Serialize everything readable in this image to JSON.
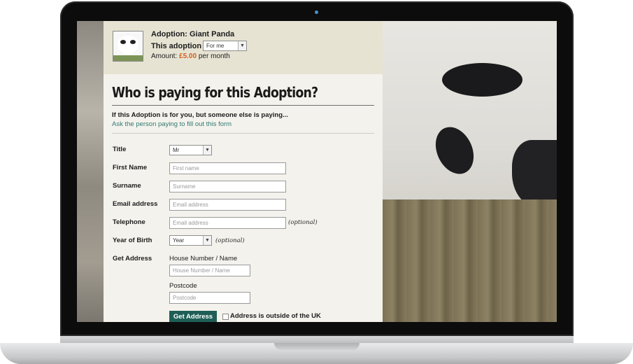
{
  "summary": {
    "title": "Adoption: Giant Panda",
    "adoption_label": "This adoption is",
    "adoption_value": "For me",
    "amount_label": "Amount:",
    "amount_value": "£5.00",
    "amount_suffix": "per month"
  },
  "heading": "Who is paying for this Adoption?",
  "note": {
    "text": "If this Adoption is for you, but someone else is paying...",
    "link": "Ask the person paying to fill out this form"
  },
  "form": {
    "title_label": "Title",
    "title_value": "Mr",
    "first_name_label": "First Name",
    "first_name_placeholder": "First name",
    "surname_label": "Surname",
    "surname_placeholder": "Surname",
    "email_label": "Email address",
    "email_placeholder": "Email address",
    "telephone_label": "Telephone",
    "telephone_placeholder": "Email address",
    "telephone_optional": "(optional)",
    "yob_label": "Year of Birth",
    "yob_value": "Year",
    "yob_optional": "(optional)",
    "address_label": "Get Address",
    "house_label": "House Number / Name",
    "house_placeholder": "House Number / Name",
    "postcode_label": "Postcode",
    "postcode_placeholder": "Postcode",
    "get_address_button": "Get Address",
    "outside_uk_label": "Address is outside of the UK"
  },
  "icons": {
    "dropdown": "chevron-down-icon"
  },
  "colors": {
    "accent_button": "#1e5e56",
    "link": "#2f7a72",
    "amount": "#d4611f",
    "summary_bg": "#e6e3d3",
    "panel_bg": "#f4f2ec"
  }
}
